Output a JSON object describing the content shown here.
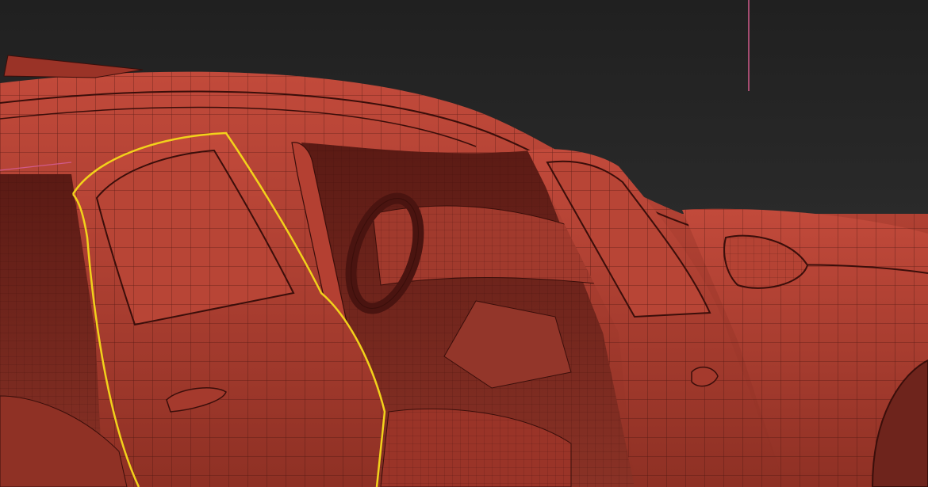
{
  "viewport": {
    "background_top": "#202020",
    "background_bottom": "#3a3a3a",
    "mesh_fill": "#a83a2e",
    "mesh_fill_dark": "#7d2a22",
    "mesh_fill_light": "#c24a3b",
    "wire_color": "#3a0e0a",
    "selection_color": "#f2d21b",
    "gizmo_color": "#d05a8a"
  },
  "scene": {
    "subject": "car-wireframe-mesh",
    "selected_object": "rear-door",
    "shading_mode": "wireframe-on-shaded"
  }
}
